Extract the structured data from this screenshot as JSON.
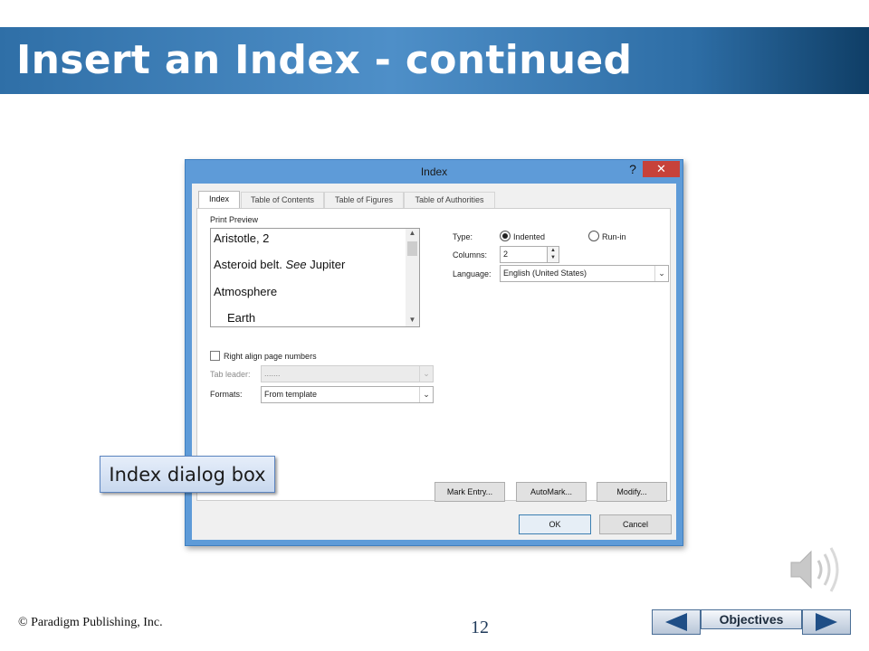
{
  "slide": {
    "title": "Insert an Index - continued",
    "callout": "Index dialog box",
    "copyright": "© Paradigm Publishing, Inc.",
    "page_number": "12",
    "nav": {
      "objectives_label": "Objectives"
    }
  },
  "dialog": {
    "title": "Index",
    "help_label": "?",
    "close_label": "✕",
    "tabs": [
      {
        "label": "Index",
        "active": true
      },
      {
        "label": "Table of Contents",
        "active": false
      },
      {
        "label": "Table of Figures",
        "active": false
      },
      {
        "label": "Table of Authorities",
        "active": false
      }
    ],
    "print_preview": {
      "label": "Print Preview",
      "lines": [
        "Aristotle, 2",
        "Asteroid belt.",
        "See",
        "Jupiter",
        "Atmosphere",
        "Earth"
      ]
    },
    "type": {
      "label": "Type:",
      "options": [
        {
          "label": "Indented",
          "selected": true
        },
        {
          "label": "Run-in",
          "selected": false
        }
      ]
    },
    "columns": {
      "label": "Columns:",
      "value": "2"
    },
    "language": {
      "label": "Language:",
      "value": "English (United States)"
    },
    "right_align": {
      "label": "Right align page numbers",
      "checked": false
    },
    "tab_leader": {
      "label": "Tab leader:",
      "value": "......."
    },
    "formats": {
      "label": "Formats:",
      "value": "From template"
    },
    "buttons": {
      "mark_entry": "Mark Entry...",
      "automark": "AutoMark...",
      "modify": "Modify...",
      "ok": "OK",
      "cancel": "Cancel"
    }
  },
  "colors": {
    "banner": "#2f6fa7",
    "dialog_frame": "#5e9bd8",
    "close_button": "#c7423a"
  },
  "icons": [
    "speaker-icon",
    "arrow-left-icon",
    "arrow-right-icon"
  ]
}
